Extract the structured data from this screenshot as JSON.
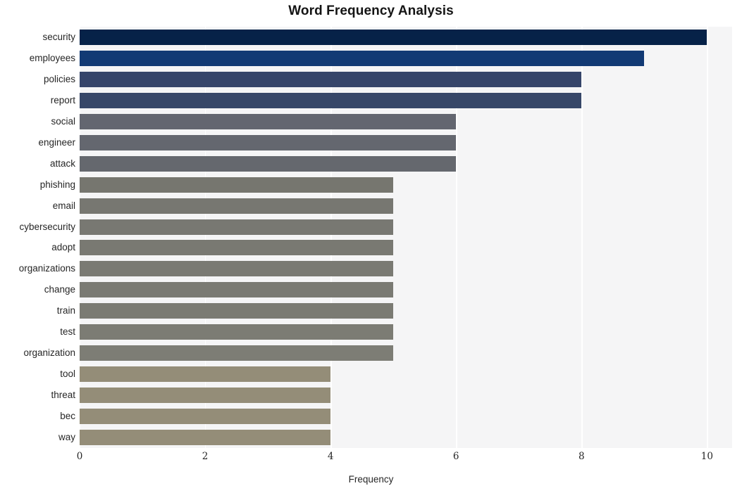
{
  "chart_data": {
    "type": "bar",
    "orientation": "horizontal",
    "title": "Word Frequency Analysis",
    "xlabel": "Frequency",
    "ylabel": "",
    "xlim": [
      0,
      10.4
    ],
    "xticks": [
      0,
      2,
      4,
      6,
      8,
      10
    ],
    "xtick_labels": [
      "0",
      "2",
      "4",
      "6",
      "8",
      "10"
    ],
    "grid": "vertical-white-on-gray",
    "legend": "none",
    "categories": [
      "security",
      "employees",
      "policies",
      "report",
      "social",
      "engineer",
      "attack",
      "phishing",
      "email",
      "cybersecurity",
      "adopt",
      "organizations",
      "change",
      "train",
      "test",
      "organization",
      "tool",
      "threat",
      "bec",
      "way"
    ],
    "values": [
      10,
      9,
      8,
      8,
      6,
      6,
      6,
      5,
      5,
      5,
      5,
      5,
      5,
      5,
      5,
      5,
      4,
      4,
      4,
      4
    ],
    "bar_colors": [
      "#062248",
      "#123a74",
      "#36456a",
      "#374768",
      "#636670",
      "#64676f",
      "#65686e",
      "#76766f",
      "#777771",
      "#787872",
      "#797972",
      "#7a7a73",
      "#7a7a73",
      "#7b7b73",
      "#7c7c74",
      "#7d7d75",
      "#948d78",
      "#948d78",
      "#948d78",
      "#948d78"
    ],
    "plot_background": "#f5f5f6",
    "figure_background": "#ffffff"
  }
}
